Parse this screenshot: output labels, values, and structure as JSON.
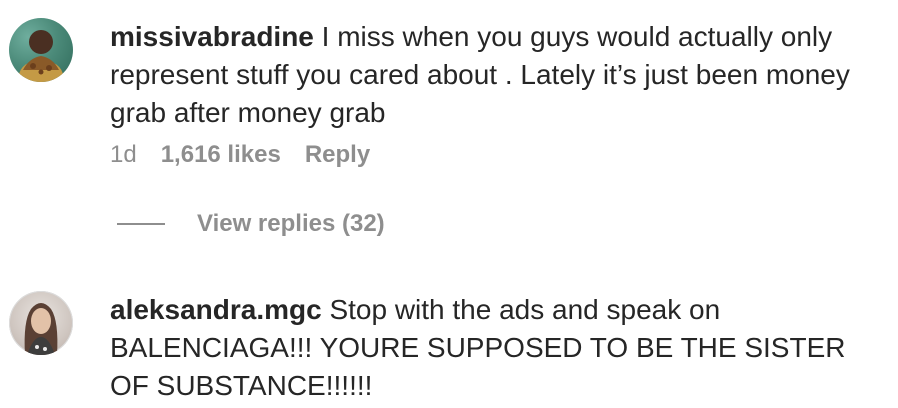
{
  "comments": [
    {
      "username": "missivabradine",
      "text": "I miss when you guys would actually only represent stuff you cared about . Lately it’s just been money grab after money grab",
      "age": "1d",
      "likes": "1,616 likes",
      "reply_label": "Reply",
      "view_replies": "View replies (32)"
    },
    {
      "username": "aleksandra.mgc",
      "text": "Stop with the ads and speak on BALENCIAGA!!! YOURE SUPPOSED TO BE THE SISTER OF SUBSTANCE!!!!!!"
    }
  ]
}
